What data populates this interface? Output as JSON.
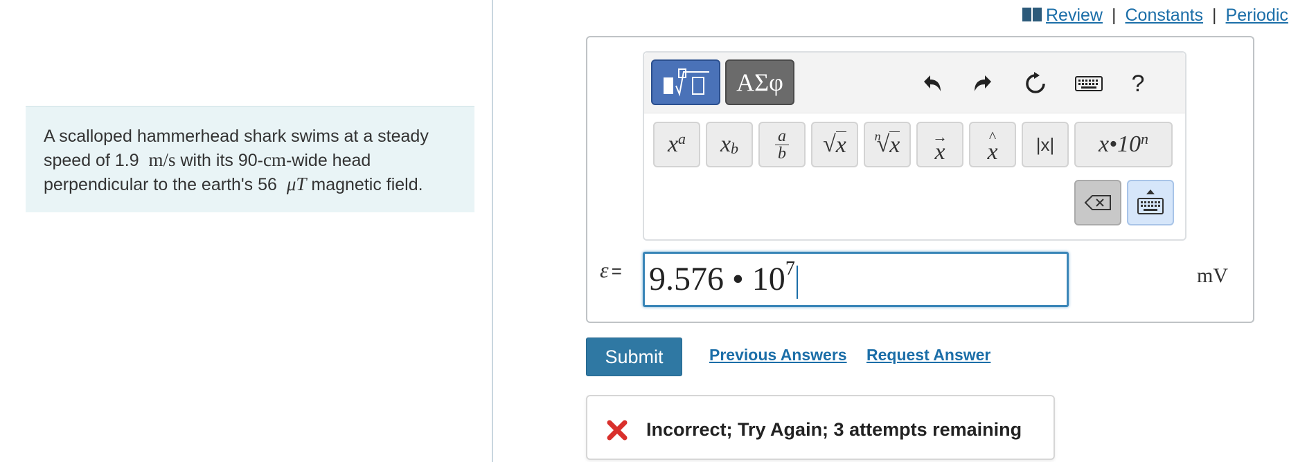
{
  "problem": {
    "text_1": "A scalloped hammerhead shark swims at a steady",
    "text_2a": "speed of 1.9",
    "text_2_unit": "m/s",
    "text_2b": "with its 90-",
    "text_2_cm": "cm",
    "text_2c": "-wide head",
    "text_3a": "perpendicular to the earth's 56",
    "text_3_unit": "μT",
    "text_3b": "magnetic field."
  },
  "top_links": {
    "review": "Review",
    "constants": "Constants",
    "periodic": "Periodic",
    "separator": "|"
  },
  "toolbar": {
    "greek_label": "ΑΣφ",
    "help_label": "?",
    "templates": {
      "superscript_base": "x",
      "superscript_exp": "a",
      "subscript_base": "x",
      "subscript_sub": "b",
      "fraction_num": "a",
      "fraction_den": "b",
      "sqrt_arg": "x",
      "nroot_index": "n",
      "nroot_arg": "x",
      "vector_arg": "x",
      "unitvec_arg": "x",
      "abs_label": "|x|",
      "sci_label": "x•10",
      "sci_exp": "n"
    }
  },
  "answer": {
    "variable": "ε",
    "equals": "=",
    "mantissa": "9.576 • 10",
    "exponent": "7",
    "unit": "mV"
  },
  "actions": {
    "submit": "Submit",
    "previous_answers": "Previous Answers",
    "request_answer": "Request Answer"
  },
  "feedback": {
    "message": "Incorrect; Try Again; 3 attempts remaining",
    "status_color": "#d9302c"
  },
  "colors": {
    "accent": "#2f78a3",
    "link": "#1b6ea8",
    "problem_bg": "#e9f4f6"
  }
}
